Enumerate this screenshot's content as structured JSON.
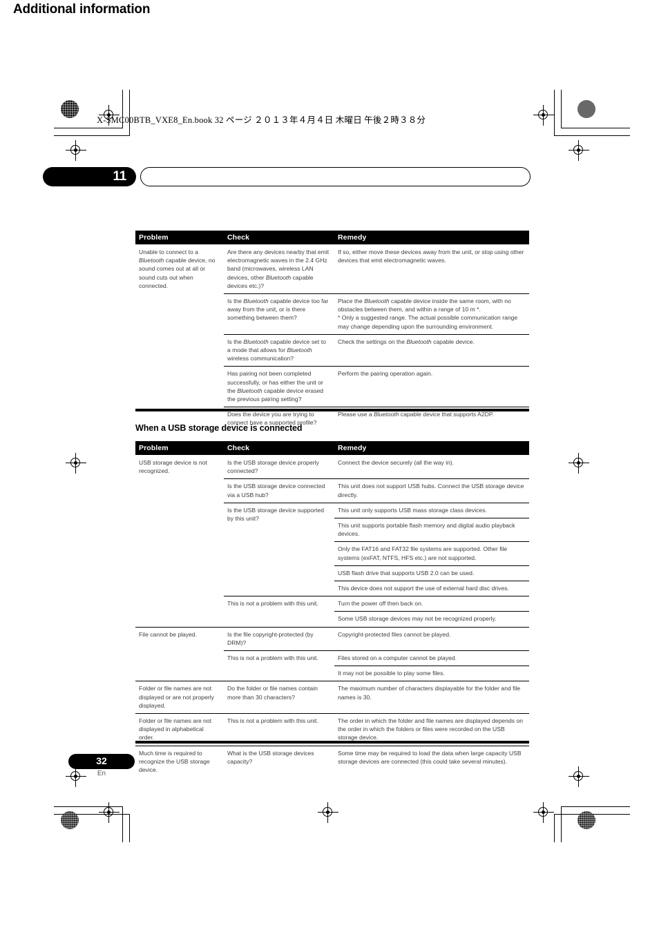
{
  "file_header": "X-SMC00BTB_VXE8_En.book   32 ページ   ２０１３年４月４日   木曜日   午後２時３８分",
  "chapter": {
    "number": "11",
    "title": "Additional information"
  },
  "footer": {
    "page_number": "32",
    "language": "En"
  },
  "colors": {
    "header_bg": "#000000",
    "header_text": "#ffffff",
    "body_text": "#3d3d3d",
    "rule": "#000000"
  },
  "bluetooth_table": {
    "columns": [
      "Problem",
      "Check",
      "Remedy"
    ],
    "rows": [
      {
        "problem": "Unable to connect to a Bluetooth capable device, no sound comes out at all or sound cuts out when connected.",
        "check": "Are there any devices nearby that emit electromagnetic waves in the 2.4 GHz band (microwaves, wireless LAN devices, other Bluetooth capable devices etc.)?",
        "remedy": "If so, either move these devices away from the unit, or stop using other devices that emit electromagnetic waves."
      },
      {
        "problem": "",
        "check": "Is the Bluetooth capable device too far away from the unit, or is there something between them?",
        "remedy": "Place the Bluetooth capable device inside the same room, with no obstacles between them, and within a range of 10 m *.\n* Only a suggested range. The actual possible communication range may change depending upon the surrounding environment."
      },
      {
        "problem": "",
        "check": "Is the Bluetooth capable device set to a mode that allows for Bluetooth wireless communication?",
        "remedy": "Check the settings on the Bluetooth capable device."
      },
      {
        "problem": "",
        "check": "Has pairing not been completed successfully, or has either the unit or the Bluetooth capable device erased the previous pairing setting?",
        "remedy": "Perform the pairing operation again."
      },
      {
        "problem": "",
        "check": "Does the device you are trying to connect have a supported profile?",
        "remedy": "Please use a Bluetooth capable device that supports A2DP."
      }
    ]
  },
  "usb_section_heading": "When a USB storage device is connected",
  "usb_table": {
    "columns": [
      "Problem",
      "Check",
      "Remedy"
    ],
    "rows": [
      {
        "problem": "USB storage device is not recognized.",
        "check": "Is the USB storage device properly connected?",
        "remedy": "Connect the device securely (all the way in)."
      },
      {
        "problem": "",
        "check": "Is the USB storage device connected via a USB hub?",
        "remedy": "This unit does not support USB hubs. Connect the USB storage device directly."
      },
      {
        "problem": "",
        "check": "Is the USB storage device supported by this unit?",
        "remedy": "This unit only supports USB mass storage class devices."
      },
      {
        "problem": "",
        "check": "",
        "remedy": "This unit supports portable flash memory and digital audio playback devices."
      },
      {
        "problem": "",
        "check": "",
        "remedy": "Only the FAT16 and FAT32 file systems are supported. Other file systems (exFAT, NTFS, HFS etc.) are not supported."
      },
      {
        "problem": "",
        "check": "",
        "remedy": "USB flash drive that supports USB 2.0 can be used."
      },
      {
        "problem": "",
        "check": "",
        "remedy": "This device does not support the use of external hard disc drives."
      },
      {
        "problem": "",
        "check": "This is not a problem with this unit.",
        "remedy": "Turn the power off then back on."
      },
      {
        "problem": "",
        "check": "",
        "remedy": "Some USB storage devices may not be recognized properly."
      },
      {
        "problem": "File cannot be played.",
        "check": "Is the file copyright-protected (by DRM)?",
        "remedy": "Copyright-protected files cannot be played."
      },
      {
        "problem": "",
        "check": "This is not a problem with this unit.",
        "remedy": "Files stored on a computer cannot be played."
      },
      {
        "problem": "",
        "check": "",
        "remedy": "It may not be possible to play some files."
      },
      {
        "problem": "Folder or file names are not displayed or are not properly displayed.",
        "check": "Do the folder or file names contain more than 30 characters?",
        "remedy": "The maximum number of characters displayable for the folder and file names is 30."
      },
      {
        "problem": "Folder or file names are not displayed in alphabetical order.",
        "check": "This is not a problem with this unit.",
        "remedy": "The order in which the folder and file names are displayed depends on the order in which the folders or files were recorded on the USB storage device."
      },
      {
        "problem": "Much time is required to recognize the USB storage device.",
        "check": "What is the USB storage devices capacity?",
        "remedy": "Some time may be required to load the data when large capacity USB storage devices are connected (this could take several minutes)."
      }
    ]
  }
}
